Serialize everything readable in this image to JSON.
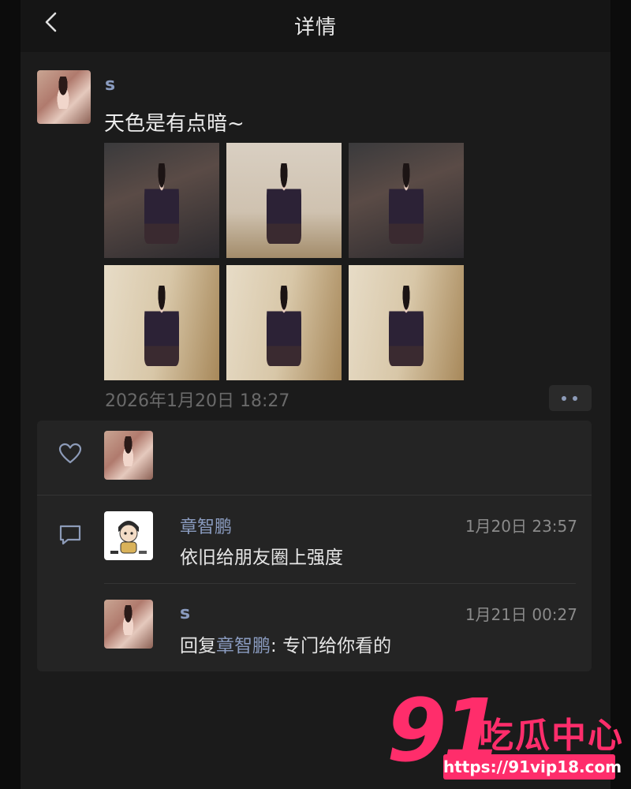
{
  "header": {
    "title": "详情"
  },
  "post": {
    "author": "s",
    "text": "天色是有点暗~",
    "photo_count": 6,
    "time": "2026年1月20日 18:27"
  },
  "comments": [
    {
      "author": "章智鹏",
      "time": "1月20日 23:57",
      "text": "依旧给朋友圈上强度"
    },
    {
      "author": "s",
      "time": "1月21日 00:27",
      "reply_prefix": "回复",
      "reply_to": "章智鹏",
      "reply_sep": ": ",
      "text": "专门给你看的"
    }
  ],
  "watermark": {
    "num": "91",
    "name": "吃瓜中心",
    "url": "https://91vip18.com"
  },
  "colors": {
    "name_link": "#8a9bbf",
    "accent_watermark": "#ff2d6b"
  }
}
